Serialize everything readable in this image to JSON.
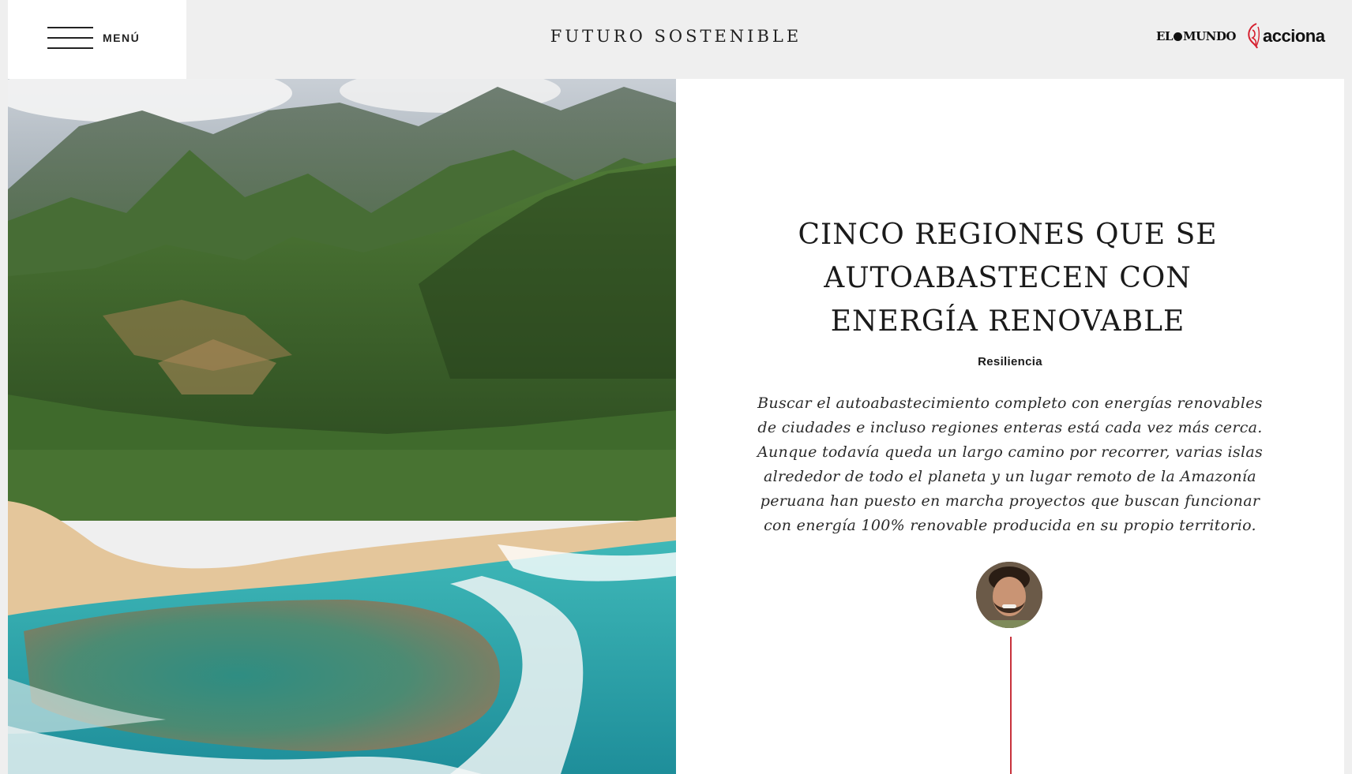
{
  "header": {
    "menu_label": "MENÚ",
    "site_title": "FUTURO SOSTENIBLE",
    "logo_elmundo": {
      "left": "EL",
      "right": "MUNDO"
    },
    "logo_acciona": "acciona"
  },
  "article": {
    "headline": "CINCO REGIONES QUE SE AUTOABASTECEN CON ENERGÍA RENOVABLE",
    "category": "Resiliencia",
    "summary": "Buscar el autoabastecimiento completo con energías renovables de ciudades e incluso regiones enteras está cada vez más cerca. Aunque todavía queda un largo camino por recorrer, varias islas alrededor de todo el planeta y un lugar remoto de la Amazonía peruana han puesto en marcha proyectos que buscan funcionar con energía 100% renovable producida en su propio territorio."
  },
  "colors": {
    "accent": "#c8323c",
    "header_bg": "#efefef",
    "panel_bg": "#ffffff"
  },
  "icons": {
    "menu": "hamburger-icon",
    "elmundo_globe": "globe-icon",
    "acciona_mark": "acciona-logo-mark"
  }
}
